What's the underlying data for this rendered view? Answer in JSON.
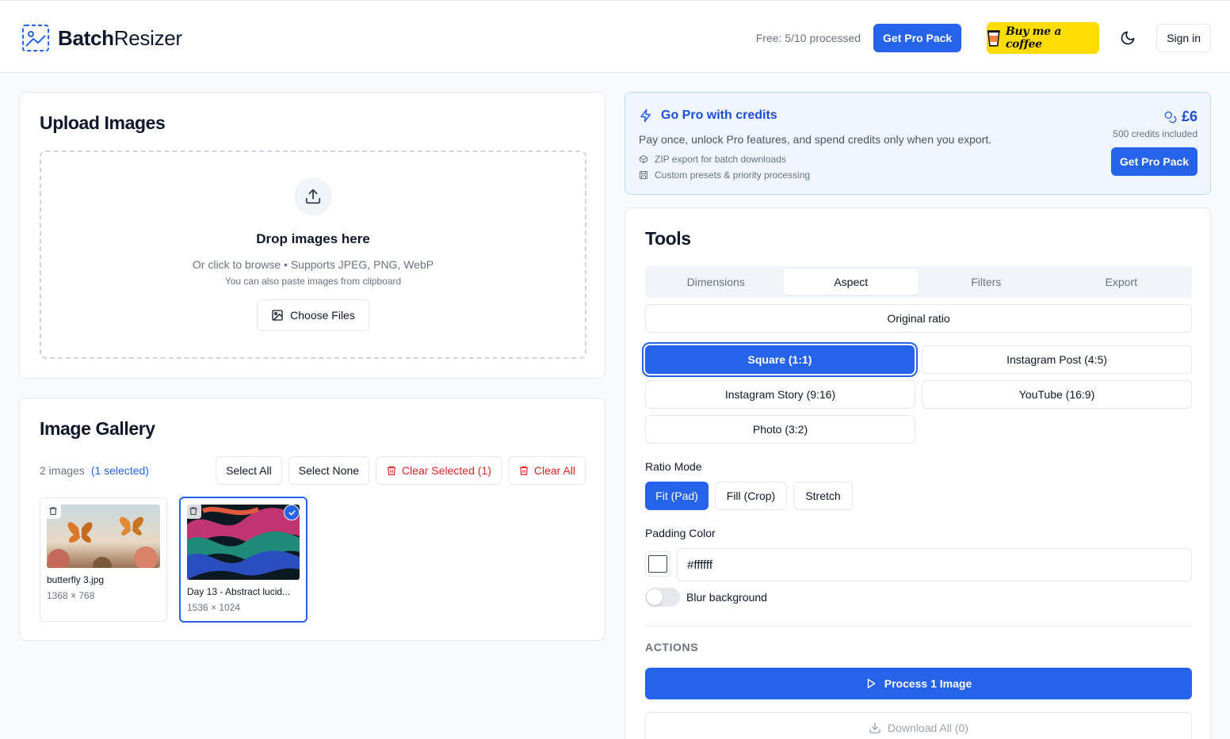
{
  "header": {
    "logo_bold": "Batch",
    "logo_light": "Resizer",
    "quota": "Free: 5/10 processed",
    "pro_label": "Get Pro Pack",
    "coffee_label": "Buy me a coffee",
    "signin_label": "Sign in"
  },
  "upload": {
    "title": "Upload Images",
    "drop_title": "Drop images here",
    "drop_sub": "Or click to browse • Supports JPEG, PNG, WebP",
    "paste_hint": "You can also paste images from clipboard",
    "choose_label": "Choose Files"
  },
  "gallery": {
    "title": "Image Gallery",
    "count": "2 images",
    "selected": "(1 selected)",
    "select_all": "Select All",
    "select_none": "Select None",
    "clear_selected": "Clear Selected (1)",
    "clear_all": "Clear All",
    "images": [
      {
        "name": "butterfly 3.jpg",
        "dims": "1368 × 768"
      },
      {
        "name": "Day 13 - Abstract lucid...",
        "dims": "1536 × 1024"
      }
    ]
  },
  "pro": {
    "title": "Go Pro with credits",
    "desc": "Pay once, unlock Pro features, and spend credits only when you export.",
    "features": [
      "ZIP export for batch downloads",
      "Custom presets & priority processing"
    ],
    "price": "£6",
    "credits": "500 credits included",
    "button": "Get Pro Pack"
  },
  "tools": {
    "title": "Tools",
    "tabs": [
      "Dimensions",
      "Aspect",
      "Filters",
      "Export"
    ],
    "original_ratio": "Original ratio",
    "ratios": [
      "Square (1:1)",
      "Instagram Post (4:5)",
      "Instagram Story (9:16)",
      "YouTube (16:9)",
      "Photo (3:2)"
    ],
    "ratio_mode_label": "Ratio Mode",
    "modes": [
      "Fit (Pad)",
      "Fill (Crop)",
      "Stretch"
    ],
    "padding_label": "Padding Color",
    "padding_value": "#ffffff",
    "blur_label": "Blur background",
    "actions_label": "ACTIONS",
    "process_label": "Process 1 Image",
    "download_label": "Download All (0)"
  },
  "colors": {
    "primary": "#2563eb",
    "danger": "#dc2626",
    "coffee": "#ffdd00"
  }
}
